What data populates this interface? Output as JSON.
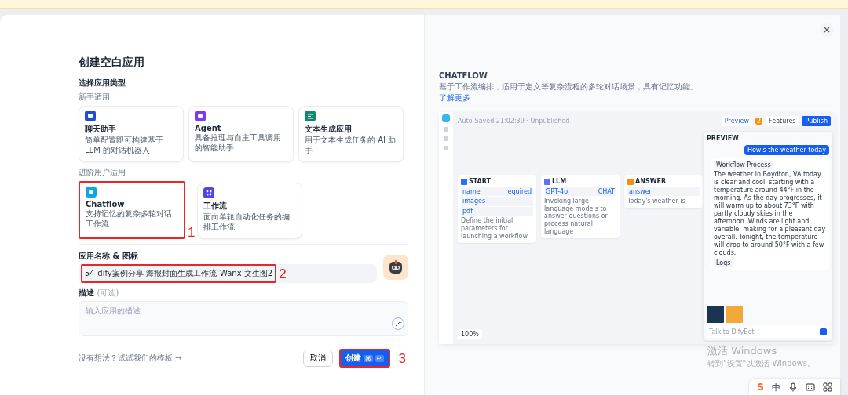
{
  "dialog": {
    "title": "创建空白应用",
    "type_heading": "选择应用类型",
    "groups": [
      {
        "label": "新手适用",
        "cards": [
          {
            "kind": "chat",
            "title": "聊天助手",
            "desc": "简单配置即可构建基于 LLM 的对话机器人",
            "selected": false,
            "color": "#1d4ed8"
          },
          {
            "kind": "agent",
            "title": "Agent",
            "desc": "具备推理与自主工具调用的智能助手",
            "selected": false,
            "color": "#7c3aed"
          },
          {
            "kind": "text",
            "title": "文本生成应用",
            "desc": "用于文本生成任务的 AI 助手",
            "selected": false,
            "color": "#0f8a6c"
          }
        ]
      },
      {
        "label": "进阶用户适用",
        "cards": [
          {
            "kind": "chatflow",
            "title": "Chatflow",
            "desc": "支持记忆的复杂多轮对话工作流",
            "selected": true,
            "color": "#0ea5e9"
          },
          {
            "kind": "workflow",
            "title": "工作流",
            "desc": "面向单轮自动化任务的编排工作流",
            "selected": false,
            "color": "#4f46e5"
          }
        ]
      }
    ],
    "name_label": "应用名称 & 图标",
    "name_value": "54-dify案例分享-海报封面生成工作流-Wanx 文生图2",
    "desc_label": "描述",
    "desc_optional": "(可选)",
    "desc_placeholder": "输入应用的描述",
    "template_link": "没有想法？试试我们的模板 →",
    "cancel": "取消",
    "create": "创建",
    "create_keys": [
      "⌘",
      "↵"
    ],
    "annotations": [
      "1",
      "2",
      "3"
    ]
  },
  "preview": {
    "title": "CHATFLOW",
    "desc": "基于工作流编排，适用于定义等复杂流程的多轮对话场景，具有记忆功能。",
    "link": "了解更多",
    "app": {
      "status": "Auto-Saved 21:02:39 · Unpublished",
      "preview_btn": "Preview",
      "badge": "2",
      "features": "Features",
      "publish": "Publish",
      "nodes": [
        {
          "kind": "start",
          "title": "START",
          "fields": [
            {
              "name": "name",
              "tag": "required"
            },
            {
              "name": "images"
            },
            {
              "name": "pdf"
            }
          ],
          "note": "Define the initial parameters for launching a workflow"
        },
        {
          "kind": "llm",
          "title": "LLM",
          "fields": [
            {
              "name": "GPT-4o",
              "tag": "CHAT"
            }
          ],
          "note": "Invoking large language models to answer questions or process natural language"
        },
        {
          "kind": "answer",
          "title": "ANSWER",
          "fields": [
            {
              "name": "answer"
            }
          ],
          "note": "Today's weather is"
        }
      ],
      "zoom": "100%",
      "chat": {
        "title": "PREVIEW",
        "question": "How's the weather today",
        "process": "Workflow Process",
        "answer": "The weather in Boydton, VA today is clear and cool, starting with a temperature around 44°F in the morning. As the day progresses, it will warm up to about 73°F with partly cloudy skies in the afternoon. Winds are light and variable, making for a pleasant day overall. Tonight, the temperature will drop to around 50°F with a few clouds.",
        "logs": "Logs",
        "placeholder": "Talk to DifyBot"
      }
    }
  },
  "windows_notice": {
    "title": "激活 Windows",
    "hint": "转到\"设置\"以激活 Windows。"
  },
  "ime_bar": {
    "logo": "S",
    "mode": "中"
  }
}
